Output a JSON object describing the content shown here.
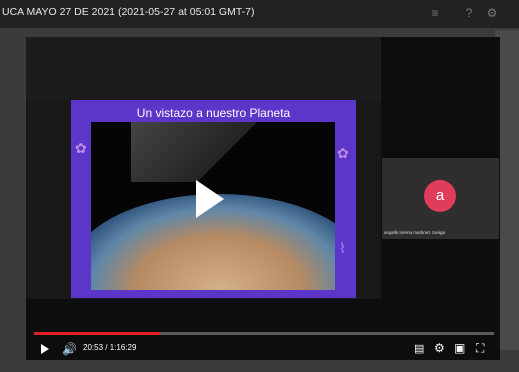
{
  "window": {
    "title": "UCA MAYO 27 DE 2021 (2021-05-27 at 05:01 GMT-7)"
  },
  "slide": {
    "title": "Un vistazo a nuestro Planeta"
  },
  "participant": {
    "initial": "a",
    "name": "angelik lorena martinez zuniga",
    "avatar_color": "#e03d5d"
  },
  "player": {
    "time_current": "20:53",
    "time_separator": " / ",
    "time_total": "1:16:29",
    "progress_fraction": 0.273,
    "progress_color": "#e02020"
  },
  "icons": {
    "top": [
      "layout-icon",
      "help-icon",
      "settings-icon"
    ],
    "controls": [
      "play-icon",
      "volume-icon",
      "captions-icon",
      "gear-icon",
      "miniplayer-icon",
      "fullscreen-icon"
    ]
  }
}
